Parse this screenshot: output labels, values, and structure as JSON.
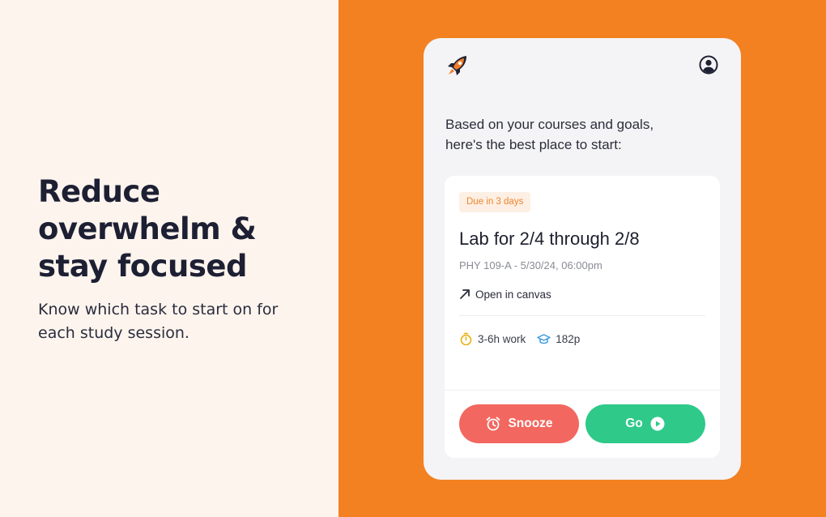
{
  "promo": {
    "headline": [
      "Reduce",
      "overwhelm &",
      "stay focused"
    ],
    "subhead": [
      "Know which task to start on for",
      "each study session."
    ]
  },
  "app": {
    "intro": [
      "Based on your courses and goals,",
      "here's the best place to start:"
    ],
    "task": {
      "due_badge": "Due in 3 days",
      "title": "Lab for 2/4 through 2/8",
      "meta": "PHY 109-A - 5/30/24, 06:00pm",
      "open_link": "Open in canvas",
      "work_estimate": "3-6h work",
      "points": "182p"
    },
    "actions": {
      "snooze_label": "Snooze",
      "go_label": "Go"
    }
  },
  "colors": {
    "background_left": "#fdf4ee",
    "background_right": "#f38121",
    "snooze": "#f2675f",
    "go": "#2fc98a",
    "badge_text": "#ef8530"
  }
}
